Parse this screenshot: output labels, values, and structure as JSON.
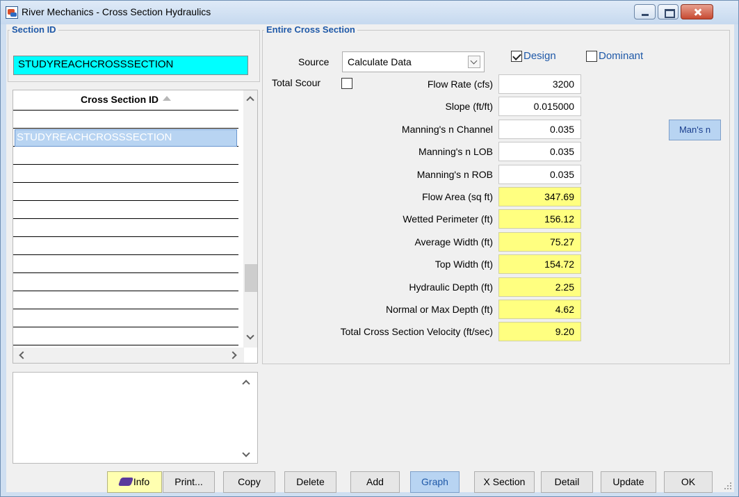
{
  "window": {
    "title": "River Mechanics - Cross Section Hydraulics"
  },
  "section_id": {
    "group_title": "Section ID",
    "value": "STUDYREACHCROSSSECTION"
  },
  "list": {
    "header": "Cross Section ID",
    "rows": [
      "",
      "STUDYREACHCROSSSECTION",
      "",
      "",
      "",
      "",
      "",
      "",
      "",
      "",
      "",
      "",
      ""
    ]
  },
  "entire": {
    "group_title": "Entire Cross Section",
    "source_label": "Source",
    "source_value": "Calculate Data",
    "design_label": "Design",
    "design_checked": true,
    "dominant_label": "Dominant",
    "dominant_checked": false,
    "total_scour_label": "Total Scour",
    "total_scour_checked": false,
    "fields": [
      {
        "label": "Flow Rate (cfs)",
        "value": "3200",
        "computed": false
      },
      {
        "label": "Slope (ft/ft)",
        "value": "0.015000",
        "computed": false
      },
      {
        "label": "Manning's n Channel",
        "value": "0.035",
        "computed": false
      },
      {
        "label": "Manning's n LOB",
        "value": "0.035",
        "computed": false
      },
      {
        "label": "Manning's n ROB",
        "value": "0.035",
        "computed": false
      },
      {
        "label": "Flow Area (sq ft)",
        "value": "347.69",
        "computed": true
      },
      {
        "label": "Wetted Perimeter (ft)",
        "value": "156.12",
        "computed": true
      },
      {
        "label": "Average Width (ft)",
        "value": "75.27",
        "computed": true
      },
      {
        "label": "Top Width (ft)",
        "value": "154.72",
        "computed": true
      },
      {
        "label": "Hydraulic Depth (ft)",
        "value": "2.25",
        "computed": true
      },
      {
        "label": "Normal or Max Depth (ft)",
        "value": "4.62",
        "computed": true
      },
      {
        "label": "Total Cross Section Velocity (ft/sec)",
        "value": "9.20",
        "computed": true
      }
    ],
    "mans_n_button": "Man's n"
  },
  "buttons": {
    "info": "Info",
    "print": "Print...",
    "copy": "Copy",
    "delete": "Delete",
    "add": "Add",
    "graph": "Graph",
    "xsection": "X Section",
    "detail": "Detail",
    "update": "Update",
    "ok": "OK"
  },
  "colors": {
    "accent": "#1f59a8",
    "cyan_field": "#00ffff",
    "computed_field": "#ffff80",
    "selection": "#b8d4f2"
  }
}
